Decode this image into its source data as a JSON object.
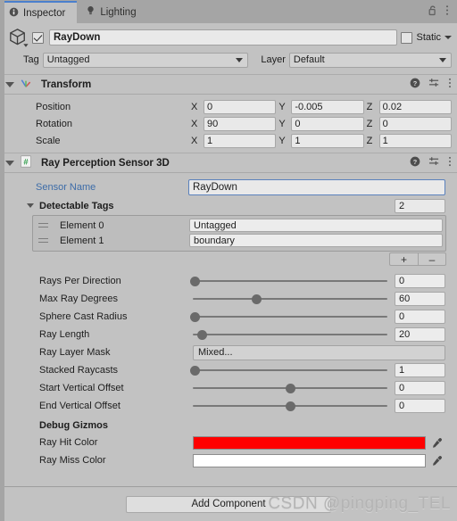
{
  "window": {
    "tabs": [
      {
        "label": "Inspector",
        "icon": "info-icon",
        "active": true
      },
      {
        "label": "Lighting",
        "icon": "light-bulb-icon",
        "active": false
      }
    ],
    "lock_icon": "padlock-open-icon",
    "menu_icon": "kebab-menu-icon"
  },
  "gameobject": {
    "icon": "cube-icon",
    "enabled": true,
    "name": "RayDown",
    "static_label": "Static",
    "static_checked": false,
    "tag_label": "Tag",
    "tag_value": "Untagged",
    "layer_label": "Layer",
    "layer_value": "Default"
  },
  "transform": {
    "title": "Transform",
    "icon": "transform-axis-icon",
    "rows": [
      {
        "label": "Position",
        "x": "0",
        "y": "-0.005",
        "z": "0.02"
      },
      {
        "label": "Rotation",
        "x": "90",
        "y": "0",
        "z": "0"
      },
      {
        "label": "Scale",
        "x": "1",
        "y": "1",
        "z": "1"
      }
    ],
    "axis_labels": [
      "X",
      "Y",
      "Z"
    ]
  },
  "sensor": {
    "title": "Ray Perception Sensor 3D",
    "icon": "csharp-script-icon",
    "sensor_name_label": "Sensor Name",
    "sensor_name_value": "RayDown",
    "detectable_tags_label": "Detectable Tags",
    "detectable_tags_count": "2",
    "elements": [
      {
        "name": "Element 0",
        "value": "Untagged"
      },
      {
        "name": "Element 1",
        "value": "boundary"
      }
    ],
    "add_element_label": "+",
    "remove_element_label": "–",
    "sliders": [
      {
        "label": "Rays Per Direction",
        "value": "0",
        "pct": 1
      },
      {
        "label": "Max Ray Degrees",
        "value": "60",
        "pct": 33
      },
      {
        "label": "Sphere Cast Radius",
        "value": "0",
        "pct": 1
      },
      {
        "label": "Ray Length",
        "value": "20",
        "pct": 5
      }
    ],
    "layer_mask_label": "Ray Layer Mask",
    "layer_mask_value": "Mixed...",
    "sliders2": [
      {
        "label": "Stacked Raycasts",
        "value": "1",
        "pct": 1
      },
      {
        "label": "Start Vertical Offset",
        "value": "0",
        "pct": 50
      },
      {
        "label": "End Vertical Offset",
        "value": "0",
        "pct": 50
      }
    ],
    "debug_gizmos_label": "Debug Gizmos",
    "hit_color_label": "Ray Hit Color",
    "hit_color": "#FF0000",
    "miss_color_label": "Ray Miss Color",
    "miss_color": "#FFFFFF",
    "eyedropper_icon": "eyedropper-icon"
  },
  "footer": {
    "add_component_label": "Add Component",
    "watermark": "CSDN @pingping_TEL"
  },
  "theme": {
    "panel_bg": "#c2c2c2",
    "outer_bg": "#a5a5a5",
    "accent_blue": "#4b7fcd",
    "link_blue": "#3d6ca8",
    "field_bg": "#e9e9e9"
  }
}
